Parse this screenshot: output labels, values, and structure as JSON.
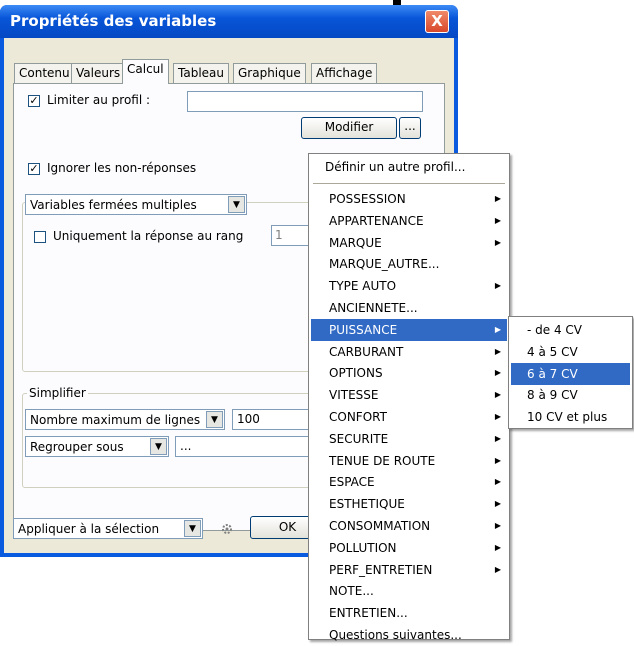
{
  "window": {
    "title": "Propriétés des variables",
    "close_glyph": "X"
  },
  "tabs": [
    "Contenu",
    "Valeurs",
    "Calcul",
    "Tableau",
    "Graphique",
    "Affichage"
  ],
  "active_tab": "Calcul",
  "profile": {
    "checkbox_label": "Limiter au profil :",
    "checked": true,
    "value": "",
    "modify_label": "Modifier",
    "ellipsis_label": "..."
  },
  "ignore_nonresponses": {
    "label": "Ignorer les non-réponses",
    "checked": true
  },
  "variables_combo": {
    "value": "Variables fermées multiples"
  },
  "rank": {
    "label": "Uniquement la réponse au rang",
    "checked": false,
    "value": "1"
  },
  "simplifier": {
    "label": "Simplifier",
    "max_lines_combo": "Nombre maximum de lignes",
    "max_lines_value": "100",
    "group_combo": "Regrouper sous",
    "group_value": "..."
  },
  "footer": {
    "apply_combo": "Appliquer à la sélection",
    "ok_label": "OK"
  },
  "menu": {
    "header": "Définir un autre profil...",
    "items": [
      {
        "label": "POSSESSION",
        "sub": true
      },
      {
        "label": "APPARTENANCE",
        "sub": true
      },
      {
        "label": "MARQUE",
        "sub": true
      },
      {
        "label": "MARQUE_AUTRE...",
        "sub": false
      },
      {
        "label": "TYPE AUTO",
        "sub": true
      },
      {
        "label": "ANCIENNETE...",
        "sub": false
      },
      {
        "label": "PUISSANCE",
        "sub": true
      },
      {
        "label": "CARBURANT",
        "sub": true
      },
      {
        "label": "OPTIONS",
        "sub": true
      },
      {
        "label": "VITESSE",
        "sub": true
      },
      {
        "label": "CONFORT",
        "sub": true
      },
      {
        "label": "SECURITE",
        "sub": true
      },
      {
        "label": "TENUE DE ROUTE",
        "sub": true
      },
      {
        "label": "ESPACE",
        "sub": true
      },
      {
        "label": "ESTHETIQUE",
        "sub": true
      },
      {
        "label": "CONSOMMATION",
        "sub": true
      },
      {
        "label": "POLLUTION",
        "sub": true
      },
      {
        "label": "PERF_ENTRETIEN",
        "sub": true
      },
      {
        "label": "NOTE...",
        "sub": false
      },
      {
        "label": "ENTRETIEN...",
        "sub": false
      },
      {
        "label": "Questions suivantes...",
        "sub": false
      }
    ],
    "selected": "PUISSANCE"
  },
  "submenu": {
    "items": [
      "- de 4 CV",
      "4 à 5 CV",
      "6 à 7 CV",
      "8 à 9 CV",
      "10 CV et plus"
    ],
    "selected": "6 à 7 CV"
  },
  "colors": {
    "titlebar": "#0856d8",
    "highlight": "#316ac5",
    "face": "#ece9d8"
  }
}
